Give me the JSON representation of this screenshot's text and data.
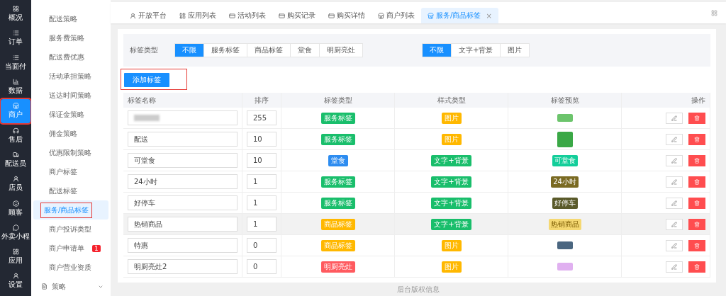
{
  "rail": [
    {
      "label": "概况",
      "selected": false,
      "highlighted": false
    },
    {
      "label": "订单",
      "selected": false,
      "highlighted": false
    },
    {
      "label": "当面付",
      "selected": false,
      "highlighted": false
    },
    {
      "label": "数据",
      "selected": false,
      "highlighted": false
    },
    {
      "label": "商户",
      "selected": true,
      "highlighted": true
    },
    {
      "label": "售后",
      "selected": false,
      "highlighted": false
    },
    {
      "label": "配送员",
      "selected": false,
      "highlighted": false
    },
    {
      "label": "店员",
      "selected": false,
      "highlighted": false
    },
    {
      "label": "顾客",
      "selected": false,
      "highlighted": false
    },
    {
      "label": "外卖小程",
      "selected": false,
      "highlighted": false
    },
    {
      "label": "应用",
      "selected": false,
      "highlighted": false
    },
    {
      "label": "设置",
      "selected": false,
      "highlighted": false
    }
  ],
  "submenu": {
    "items": [
      {
        "label": "配送策略",
        "selected": false,
        "highlighted": false
      },
      {
        "label": "服务费策略",
        "selected": false,
        "highlighted": false
      },
      {
        "label": "配送费优惠",
        "selected": false,
        "highlighted": false
      },
      {
        "label": "活动承担策略",
        "selected": false,
        "highlighted": false
      },
      {
        "label": "送达时间策略",
        "selected": false,
        "highlighted": false
      },
      {
        "label": "保证金策略",
        "selected": false,
        "highlighted": false
      },
      {
        "label": "佣金策略",
        "selected": false,
        "highlighted": false
      },
      {
        "label": "优惠限制策略",
        "selected": false,
        "highlighted": false
      },
      {
        "label": "商户标签",
        "selected": false,
        "highlighted": false
      },
      {
        "label": "配送标签",
        "selected": false,
        "highlighted": false
      },
      {
        "label": "服务/商品标签",
        "selected": true,
        "highlighted": true
      },
      {
        "label": "商户投诉类型",
        "selected": false,
        "highlighted": false
      },
      {
        "label": "商户申请单",
        "selected": false,
        "highlighted": false,
        "badge": "1"
      },
      {
        "label": "商户营业资质",
        "selected": false,
        "highlighted": false
      }
    ],
    "group": {
      "label": "策略",
      "expanded": false
    }
  },
  "tabs": [
    {
      "label": "开放平台",
      "selected": false
    },
    {
      "label": "应用列表",
      "selected": false
    },
    {
      "label": "活动列表",
      "selected": false
    },
    {
      "label": "购买记录",
      "selected": false
    },
    {
      "label": "购买详情",
      "selected": false
    },
    {
      "label": "商户列表",
      "selected": false
    },
    {
      "label": "服务/商品标签",
      "selected": true,
      "close": "×"
    }
  ],
  "filters": {
    "label": "标签类型",
    "tag_type": [
      {
        "label": "不限",
        "selected": true
      },
      {
        "label": "服务标签",
        "selected": false
      },
      {
        "label": "商品标签",
        "selected": false
      },
      {
        "label": "堂食",
        "selected": false
      },
      {
        "label": "明厨亮灶",
        "selected": false
      }
    ],
    "style_type": [
      {
        "label": "不限",
        "selected": true
      },
      {
        "label": "文字+背景",
        "selected": false
      },
      {
        "label": "图片",
        "selected": false
      }
    ]
  },
  "add_button": {
    "label": "添加标签",
    "highlighted": true
  },
  "table": {
    "columns": [
      "标签名称",
      "排序",
      "标签类型",
      "样式类型",
      "标签预览",
      "操作"
    ],
    "rows": [
      {
        "name": "",
        "blurred": true,
        "sort": "255",
        "type": {
          "label": "服务标签",
          "color": "#19be6b"
        },
        "style": {
          "label": "图片",
          "color": "#ffb800"
        },
        "preview": {
          "kind": "image",
          "color": "#6cc46c"
        },
        "hovered": false
      },
      {
        "name": "配送",
        "blurred": false,
        "sort": "10",
        "type": {
          "label": "服务标签",
          "color": "#19be6b"
        },
        "style": {
          "label": "图片",
          "color": "#ffb800"
        },
        "preview": {
          "kind": "tall",
          "color": "#3aa846"
        },
        "hovered": false
      },
      {
        "name": "可堂食",
        "blurred": false,
        "sort": "10",
        "type": {
          "label": "堂食",
          "color": "#2d8cf0"
        },
        "style": {
          "label": "文字+背景",
          "color": "#19be6b"
        },
        "preview": {
          "kind": "text",
          "text": "可堂食",
          "color": "#13ce9a"
        },
        "hovered": false
      },
      {
        "name": "24小时",
        "blurred": false,
        "sort": "1",
        "type": {
          "label": "服务标签",
          "color": "#19be6b"
        },
        "style": {
          "label": "文字+背景",
          "color": "#19be6b"
        },
        "preview": {
          "kind": "text",
          "text": "24小时",
          "color": "#7a6a22"
        },
        "hovered": false
      },
      {
        "name": "好停车",
        "blurred": false,
        "sort": "1",
        "type": {
          "label": "服务标签",
          "color": "#19be6b"
        },
        "style": {
          "label": "文字+背景",
          "color": "#19be6b"
        },
        "preview": {
          "kind": "text",
          "text": "好停车",
          "color": "#5a5a2a"
        },
        "hovered": false
      },
      {
        "name": "热销商品",
        "blurred": false,
        "sort": "1",
        "type": {
          "label": "商品标签",
          "color": "#ffb800"
        },
        "style": {
          "label": "文字+背景",
          "color": "#19be6b"
        },
        "preview": {
          "kind": "text",
          "text": "热销商品",
          "color": "#f5d872"
        },
        "hovered": true
      },
      {
        "name": "特惠",
        "blurred": false,
        "sort": "0",
        "type": {
          "label": "商品标签",
          "color": "#ffb800"
        },
        "style": {
          "label": "图片",
          "color": "#ffb800"
        },
        "preview": {
          "kind": "image",
          "color": "#4a6680"
        },
        "hovered": false
      },
      {
        "name": "明厨亮灶2",
        "blurred": false,
        "sort": "0",
        "type": {
          "label": "明厨亮灶",
          "color": "#ff5a5f"
        },
        "style": {
          "label": "图片",
          "color": "#ffb800"
        },
        "preview": {
          "kind": "image",
          "color": "#e0b0f0"
        },
        "hovered": false
      }
    ]
  },
  "footer": "后台版权信息"
}
